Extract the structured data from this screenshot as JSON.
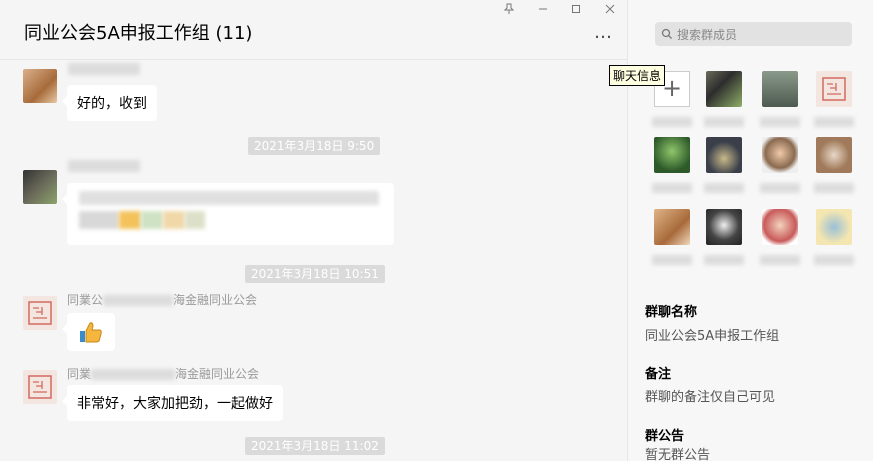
{
  "window": {
    "pin_icon": "pin-icon",
    "minimize_icon": "minimize-icon",
    "maximize_icon": "maximize-icon",
    "close_icon": "close-icon"
  },
  "chat": {
    "title": "同业公会5A申报工作组 (11)",
    "more_label": "…",
    "messages": [
      {
        "text": "好的，收到"
      },
      {
        "time": "2021年3月18日 9:50"
      },
      {
        "time": "2021年3月18日 10:51"
      },
      {
        "sender_prefix": "同業公",
        "sender_suffix": "海金融同业公会",
        "emoji": "thumbs-up-emoji"
      },
      {
        "sender_prefix": "同業",
        "sender_suffix": "海金融同业公会",
        "text": "非常好，大家加把劲，一起做好"
      },
      {
        "time": "2021年3月18日 11:02"
      }
    ]
  },
  "tooltip": "聊天信息",
  "panel": {
    "search_placeholder": "搜索群成员",
    "add_label": "+",
    "group_name_label": "群聊名称",
    "group_name_value": "同业公会5A申报工作组",
    "remark_label": "备注",
    "remark_value": "群聊的备注仅自己可见",
    "announcement_label": "群公告",
    "announcement_value": "暂无群公告"
  },
  "colors": {
    "chat_bg": "#f5f5f5",
    "bubble_bg": "#ffffff",
    "time_badge_bg": "#dadada",
    "panel_bg": "#f7f7f7"
  }
}
